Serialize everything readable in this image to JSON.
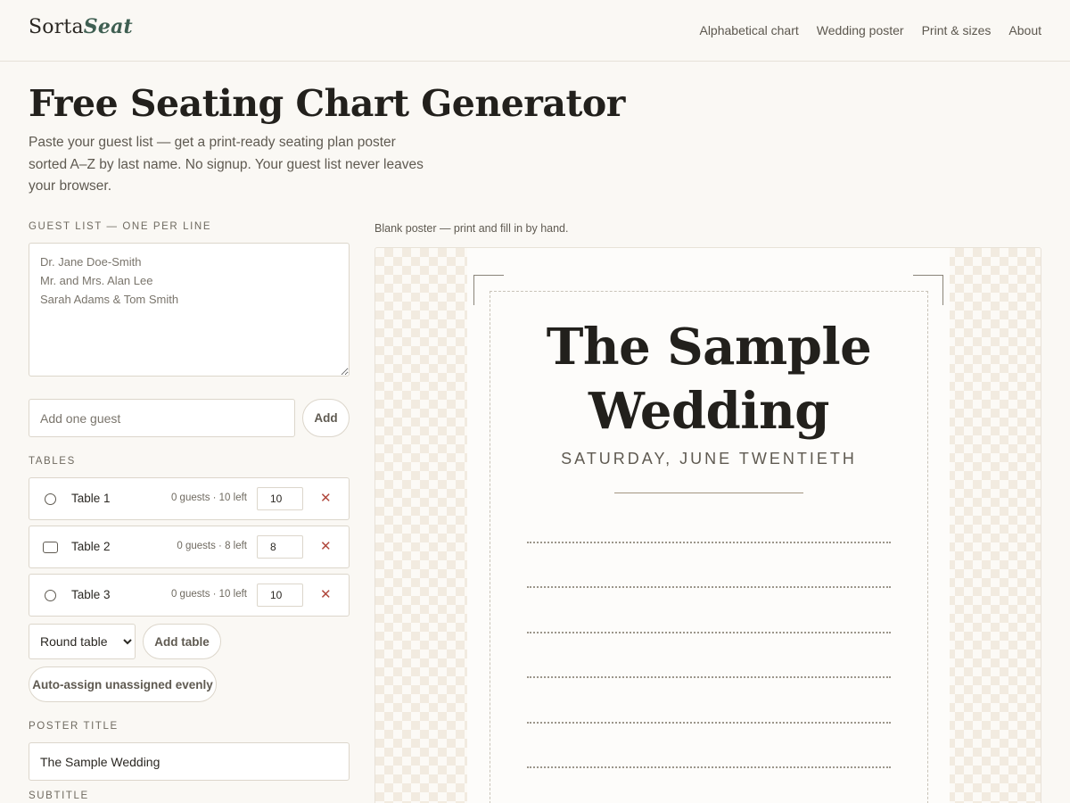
{
  "header": {
    "logo_part1": "Sorta",
    "logo_part2": "Seat",
    "nav": [
      "Alphabetical chart",
      "Wedding poster",
      "Print & sizes",
      "About"
    ]
  },
  "hero": {
    "title": "Free Seating Chart Generator",
    "subtitle": "Paste your guest list — get a print-ready seating plan poster sorted A–Z by last name. No signup. Your guest list never leaves your browser."
  },
  "guest_list": {
    "label": "GUEST LIST — ONE PER LINE",
    "value": "",
    "placeholder": "Dr. Jane Doe-Smith\nMr. and Mrs. Alan Lee\nSarah Adams & Tom Smith"
  },
  "add_guest": {
    "placeholder": "Add one guest",
    "button_label": "Add"
  },
  "tables": {
    "label": "TABLES",
    "items": [
      {
        "name": "Table 1",
        "shape": "round",
        "status": "0 guests · 10 left",
        "capacity": "10",
        "delete": "✕"
      },
      {
        "name": "Table 2",
        "shape": "rectangle",
        "status": "0 guests · 8 left",
        "capacity": "8",
        "delete": "✕"
      },
      {
        "name": "Table 3",
        "shape": "round",
        "status": "0 guests · 10 left",
        "capacity": "10",
        "delete": "✕"
      }
    ],
    "shape_select": {
      "selected": "Round table"
    },
    "add_table_label": "Add table",
    "auto_assign_label": "Auto-assign unassigned evenly"
  },
  "poster_settings": {
    "title_label": "POSTER TITLE",
    "title_value": "The Sample Wedding",
    "subtitle_label": "SUBTITLE"
  },
  "preview": {
    "caption": "Blank poster — print and fill in by hand.",
    "title_line1": "The Sample",
    "title_line2": "Wedding",
    "subtitle": "SATURDAY, JUNE TWENTIETH",
    "fill_lines": 6
  },
  "icons": {
    "round_table": "circle-outline-icon",
    "rect_table": "rounded-rect-outline-icon",
    "delete": "close-icon"
  },
  "colors": {
    "background": "#faf8f4",
    "brand_accent": "#3f5f52",
    "delete": "#b0483d",
    "text": "#2b2823"
  }
}
